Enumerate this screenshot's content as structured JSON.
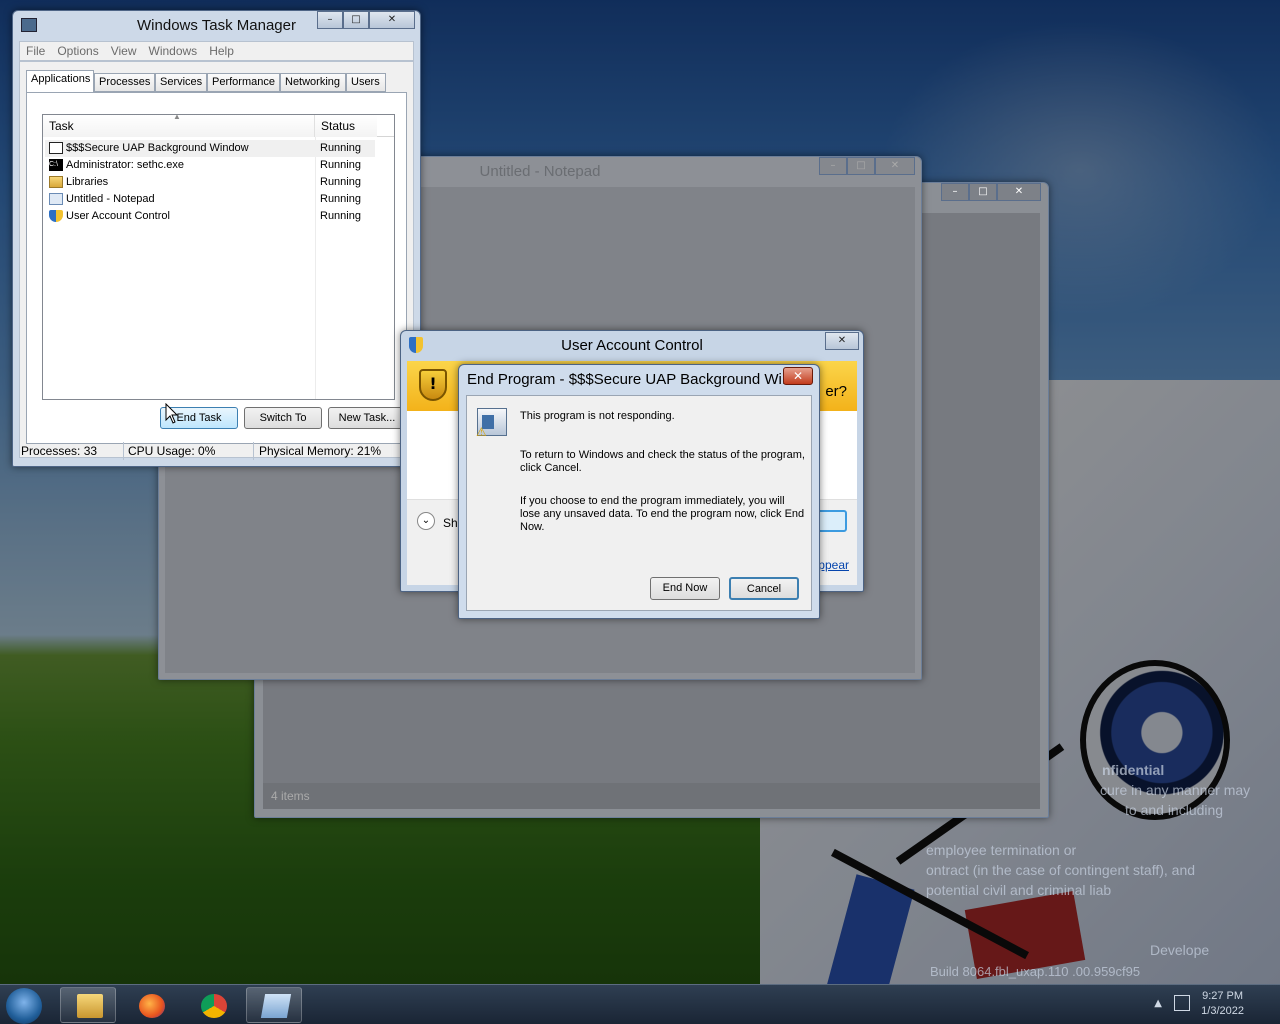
{
  "desktop": {
    "watermark": {
      "confidential": "nfidential",
      "line1": "cure in any manner may",
      "line2": "to and including",
      "line3": "employee termination or",
      "line4": "ontract (in the case of contingent staff), and",
      "line5": "potential civil and criminal liab",
      "developer": "Develope",
      "build": "Build 8064.fbl_uxap.110         .00.959cf95"
    }
  },
  "explorer": {
    "status": "4 items"
  },
  "notepad": {
    "title": "Untitled - Notepad"
  },
  "task_manager": {
    "title": "Windows Task Manager",
    "menu": [
      "File",
      "Options",
      "View",
      "Windows",
      "Help"
    ],
    "tabs": [
      "Applications",
      "Processes",
      "Services",
      "Performance",
      "Networking",
      "Users"
    ],
    "columns": {
      "task": "Task",
      "status": "Status"
    },
    "rows": [
      {
        "name": "$$$Secure UAP Background Window",
        "status": "Running",
        "icon": "window-icon"
      },
      {
        "name": "Administrator: sethc.exe",
        "status": "Running",
        "icon": "cmd-icon"
      },
      {
        "name": "Libraries",
        "status": "Running",
        "icon": "folder-icon"
      },
      {
        "name": "Untitled - Notepad",
        "status": "Running",
        "icon": "notepad-icon"
      },
      {
        "name": "User Account Control",
        "status": "Running",
        "icon": "shield-icon"
      }
    ],
    "buttons": {
      "end_task": "End Task",
      "switch_to": "Switch To",
      "new_task": "New Task..."
    },
    "status": {
      "processes": "Processes: 33",
      "cpu": "CPU Usage: 0%",
      "memory": "Physical Memory: 21%"
    }
  },
  "uac": {
    "title": "User Account Control",
    "partial_question": "er?",
    "show_details": "Sho",
    "link_partial": "ppear"
  },
  "end_program": {
    "title": "End Program - $$$Secure UAP Background Wi...",
    "msg1": "This program is not responding.",
    "msg2": "To return to Windows and check the status of the program, click Cancel.",
    "msg3": "If you choose to end the program immediately, you will lose any unsaved data. To end the program now, click End Now.",
    "end_now": "End Now",
    "cancel": "Cancel"
  },
  "taskbar": {
    "time": "9:27 PM",
    "date": "1/3/2022"
  }
}
